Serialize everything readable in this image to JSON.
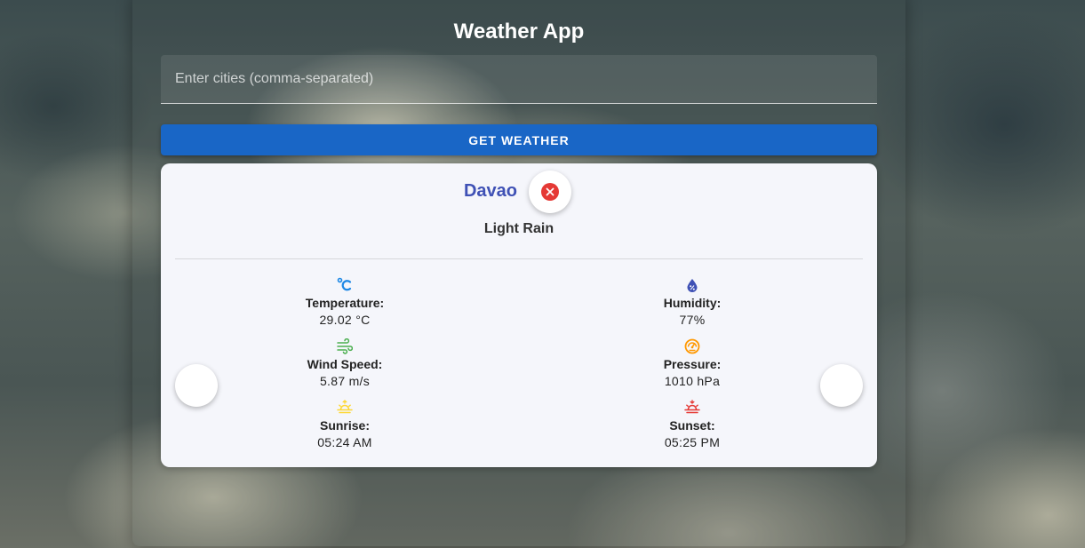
{
  "app": {
    "title": "Weather App"
  },
  "search": {
    "placeholder": "Enter cities (comma-separated)",
    "value": ""
  },
  "actions": {
    "get_weather_label": "GET WEATHER"
  },
  "weather_card": {
    "city": "Davao",
    "condition": "Light Rain",
    "stats": {
      "temperature": {
        "label": "Temperature:",
        "value": "29.02 °C",
        "icon": "thermometer-celsius-icon",
        "color": "#1e88e5"
      },
      "humidity": {
        "label": "Humidity:",
        "value": "77%",
        "icon": "water-drop-icon",
        "color": "#3f51b5"
      },
      "wind": {
        "label": "Wind Speed:",
        "value": "5.87 m/s",
        "icon": "wind-icon",
        "color": "#4caf50"
      },
      "pressure": {
        "label": "Pressure:",
        "value": "1010 hPa",
        "icon": "gauge-icon",
        "color": "#ff9800"
      },
      "sunrise": {
        "label": "Sunrise:",
        "value": "05:24 AM",
        "icon": "sunrise-icon",
        "color": "#fdd835"
      },
      "sunset": {
        "label": "Sunset:",
        "value": "05:25 PM",
        "icon": "sunset-icon",
        "color": "#e53935"
      }
    }
  },
  "colors": {
    "accent": "#1966c6",
    "city_name": "#3f51b5",
    "close": "#e53935"
  }
}
